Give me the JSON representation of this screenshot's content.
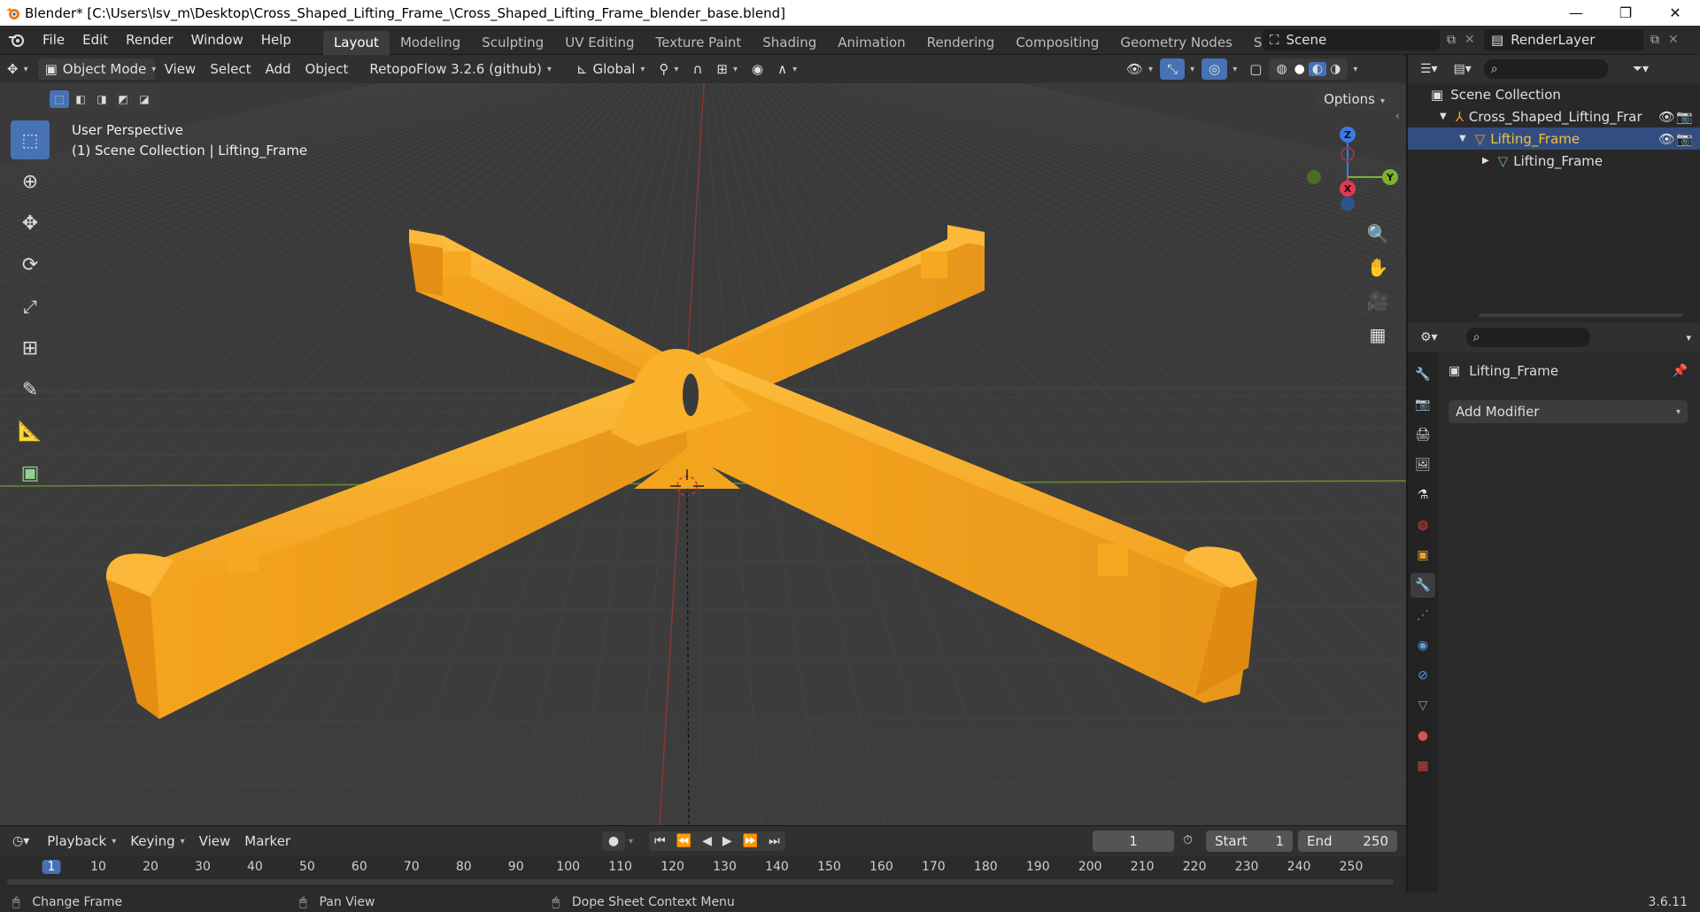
{
  "window": {
    "title": "Blender* [C:\\Users\\lsv_m\\Desktop\\Cross_Shaped_Lifting_Frame_\\Cross_Shaped_Lifting_Frame_blender_base.blend]"
  },
  "menu": [
    "File",
    "Edit",
    "Render",
    "Window",
    "Help"
  ],
  "workspaces": [
    {
      "label": "Layout",
      "active": true
    },
    {
      "label": "Modeling"
    },
    {
      "label": "Sculpting"
    },
    {
      "label": "UV Editing"
    },
    {
      "label": "Texture Paint"
    },
    {
      "label": "Shading"
    },
    {
      "label": "Animation"
    },
    {
      "label": "Rendering"
    },
    {
      "label": "Compositing"
    },
    {
      "label": "Geometry Nodes"
    },
    {
      "label": "Scripting"
    }
  ],
  "add_workspace": "+",
  "scene": {
    "label": "Scene"
  },
  "render_layer": {
    "label": "RenderLayer"
  },
  "header": {
    "mode": "Object Mode",
    "menus": [
      "View",
      "Select",
      "Add",
      "Object"
    ],
    "addon": "RetopoFlow 3.2.6 (github)",
    "orientation": "Global"
  },
  "viewport": {
    "perspective": "User Perspective",
    "collection": "(1) Scene Collection | Lifting_Frame",
    "options": "Options",
    "gizmo": {
      "z": "Z",
      "y": "Y",
      "x": "X"
    }
  },
  "outliner": {
    "root": "Scene Collection",
    "items": [
      {
        "label": "Cross_Shaped_Lifting_Frar",
        "indent": 1
      },
      {
        "label": "Lifting_Frame",
        "indent": 2,
        "selected": true
      },
      {
        "label": "Lifting_Frame",
        "indent": 3
      }
    ]
  },
  "properties": {
    "object_name": "Lifting_Frame",
    "add_modifier": "Add Modifier"
  },
  "timeline": {
    "menus": [
      "Playback",
      "Keying",
      "View",
      "Marker"
    ],
    "current_frame": "1",
    "start_label": "Start",
    "start": "1",
    "end_label": "End",
    "end": "250",
    "ticks": [
      "1",
      "10",
      "20",
      "30",
      "40",
      "50",
      "60",
      "70",
      "80",
      "90",
      "100",
      "110",
      "120",
      "130",
      "140",
      "150",
      "160",
      "170",
      "180",
      "190",
      "200",
      "210",
      "220",
      "230",
      "240",
      "250"
    ]
  },
  "status": {
    "left": "Change Frame",
    "middle": "Pan View",
    "right": "Dope Sheet Context Menu",
    "version": "3.6.11"
  },
  "colors": {
    "accent": "#4772b3",
    "object_orange": "#f5a020",
    "selected_text": "#f0c040"
  }
}
